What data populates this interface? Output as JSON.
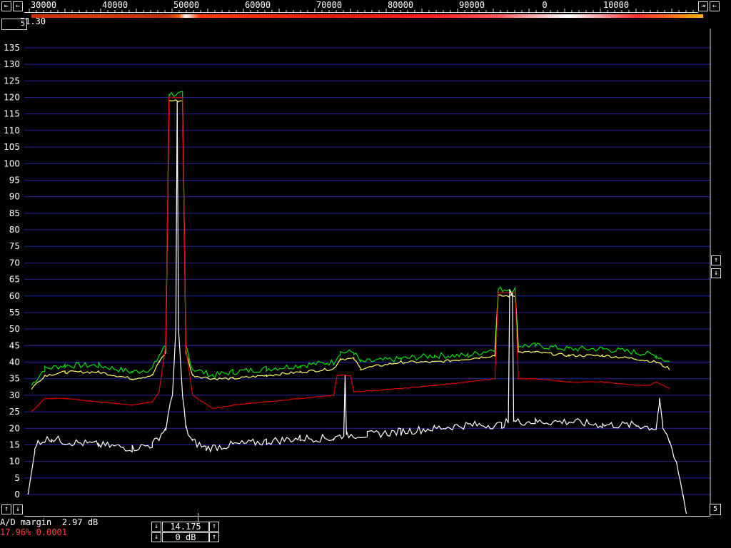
{
  "header": {
    "freq_labels": [
      "30000",
      "40000",
      "50000",
      "60000",
      "70000",
      "80000",
      "90000",
      "0",
      "10000"
    ],
    "btn_left_a": "⇤",
    "btn_left_b": "←",
    "btn_right_a": "⇥",
    "btn_right_b": "←",
    "top_value": "51.30",
    "top_box": "5"
  },
  "side": {
    "up_label": "↑",
    "down_label": "↓",
    "corner_value": "5"
  },
  "footer": {
    "ad_margin": "A/D margin  2.97 dB",
    "stats": "17.96% 0.0001",
    "freq_value": "14.175",
    "gain_value": "0 dB"
  },
  "colors": {
    "grid": "#2323a0",
    "green": "#00e000",
    "yellow": "#ffff60",
    "red": "#e00000",
    "white": "#ffffff"
  },
  "chart_data": {
    "type": "line",
    "title": "",
    "xlabel": "",
    "ylabel": "",
    "ylim": [
      -5,
      137
    ],
    "yticks": [
      0,
      5,
      10,
      15,
      20,
      25,
      30,
      35,
      40,
      45,
      50,
      55,
      60,
      65,
      70,
      75,
      80,
      85,
      90,
      95,
      100,
      105,
      110,
      115,
      120,
      125,
      130,
      135
    ],
    "x_ticks_px_note": "",
    "series": [
      {
        "color_key": "green",
        "points": [
          [
            0,
            33
          ],
          [
            0.02,
            38
          ],
          [
            0.05,
            39
          ],
          [
            0.1,
            39
          ],
          [
            0.15,
            37
          ],
          [
            0.18,
            38
          ],
          [
            0.19,
            42
          ],
          [
            0.2,
            45
          ],
          [
            0.205,
            121
          ],
          [
            0.225,
            121
          ],
          [
            0.23,
            45
          ],
          [
            0.24,
            38
          ],
          [
            0.27,
            36
          ],
          [
            0.3,
            37
          ],
          [
            0.35,
            38
          ],
          [
            0.4,
            39
          ],
          [
            0.45,
            40
          ],
          [
            0.46,
            43
          ],
          [
            0.48,
            43
          ],
          [
            0.49,
            40
          ],
          [
            0.55,
            41
          ],
          [
            0.6,
            42
          ],
          [
            0.65,
            42
          ],
          [
            0.69,
            44
          ],
          [
            0.695,
            62
          ],
          [
            0.72,
            62
          ],
          [
            0.725,
            45
          ],
          [
            0.75,
            45
          ],
          [
            0.8,
            44
          ],
          [
            0.85,
            44
          ],
          [
            0.9,
            43
          ],
          [
            0.93,
            42
          ],
          [
            0.95,
            40
          ]
        ]
      },
      {
        "color_key": "yellow",
        "points": [
          [
            0,
            32
          ],
          [
            0.02,
            36
          ],
          [
            0.05,
            37
          ],
          [
            0.1,
            37
          ],
          [
            0.15,
            35
          ],
          [
            0.18,
            36
          ],
          [
            0.19,
            40
          ],
          [
            0.2,
            43
          ],
          [
            0.205,
            119
          ],
          [
            0.225,
            119
          ],
          [
            0.23,
            43
          ],
          [
            0.24,
            36
          ],
          [
            0.27,
            35
          ],
          [
            0.3,
            35
          ],
          [
            0.35,
            36
          ],
          [
            0.4,
            37
          ],
          [
            0.45,
            38
          ],
          [
            0.46,
            41
          ],
          [
            0.48,
            41
          ],
          [
            0.49,
            38
          ],
          [
            0.55,
            40
          ],
          [
            0.6,
            40
          ],
          [
            0.65,
            41
          ],
          [
            0.69,
            42
          ],
          [
            0.695,
            60
          ],
          [
            0.72,
            60
          ],
          [
            0.725,
            43
          ],
          [
            0.75,
            43
          ],
          [
            0.8,
            42
          ],
          [
            0.85,
            42
          ],
          [
            0.9,
            41
          ],
          [
            0.93,
            40
          ],
          [
            0.95,
            38
          ]
        ]
      },
      {
        "color_key": "red",
        "points": [
          [
            0,
            25
          ],
          [
            0.02,
            29
          ],
          [
            0.05,
            29
          ],
          [
            0.1,
            28
          ],
          [
            0.15,
            27
          ],
          [
            0.18,
            28
          ],
          [
            0.19,
            31
          ],
          [
            0.2,
            45
          ],
          [
            0.205,
            120
          ],
          [
            0.225,
            120
          ],
          [
            0.23,
            44
          ],
          [
            0.24,
            30
          ],
          [
            0.27,
            26
          ],
          [
            0.3,
            27
          ],
          [
            0.35,
            28
          ],
          [
            0.4,
            29
          ],
          [
            0.45,
            30
          ],
          [
            0.455,
            36
          ],
          [
            0.475,
            36
          ],
          [
            0.48,
            31
          ],
          [
            0.55,
            32
          ],
          [
            0.6,
            33
          ],
          [
            0.65,
            34
          ],
          [
            0.69,
            35
          ],
          [
            0.695,
            61
          ],
          [
            0.72,
            61
          ],
          [
            0.725,
            35
          ],
          [
            0.75,
            35
          ],
          [
            0.8,
            34
          ],
          [
            0.85,
            34
          ],
          [
            0.9,
            33
          ],
          [
            0.92,
            33
          ],
          [
            0.93,
            34
          ],
          [
            0.95,
            32
          ]
        ]
      },
      {
        "color_key": "white",
        "points": [
          [
            -0.005,
            0
          ],
          [
            0.005,
            13
          ],
          [
            0.01,
            16
          ],
          [
            0.03,
            17
          ],
          [
            0.05,
            16
          ],
          [
            0.1,
            15
          ],
          [
            0.15,
            14
          ],
          [
            0.18,
            15
          ],
          [
            0.2,
            20
          ],
          [
            0.21,
            30
          ],
          [
            0.215,
            50
          ],
          [
            0.217,
            119
          ],
          [
            0.219,
            50
          ],
          [
            0.225,
            30
          ],
          [
            0.23,
            20
          ],
          [
            0.24,
            16
          ],
          [
            0.26,
            14
          ],
          [
            0.3,
            15
          ],
          [
            0.35,
            16
          ],
          [
            0.4,
            17
          ],
          [
            0.45,
            17
          ],
          [
            0.465,
            18
          ],
          [
            0.467,
            36
          ],
          [
            0.469,
            18
          ],
          [
            0.5,
            18
          ],
          [
            0.55,
            19
          ],
          [
            0.6,
            20
          ],
          [
            0.65,
            21
          ],
          [
            0.7,
            21
          ],
          [
            0.71,
            22
          ],
          [
            0.712,
            61
          ],
          [
            0.716,
            61
          ],
          [
            0.718,
            22
          ],
          [
            0.75,
            22
          ],
          [
            0.8,
            22
          ],
          [
            0.85,
            21
          ],
          [
            0.9,
            21
          ],
          [
            0.93,
            20
          ],
          [
            0.935,
            28
          ],
          [
            0.94,
            20
          ],
          [
            0.95,
            16
          ],
          [
            0.96,
            10
          ],
          [
            0.97,
            0
          ],
          [
            0.975,
            -5
          ]
        ]
      }
    ]
  }
}
